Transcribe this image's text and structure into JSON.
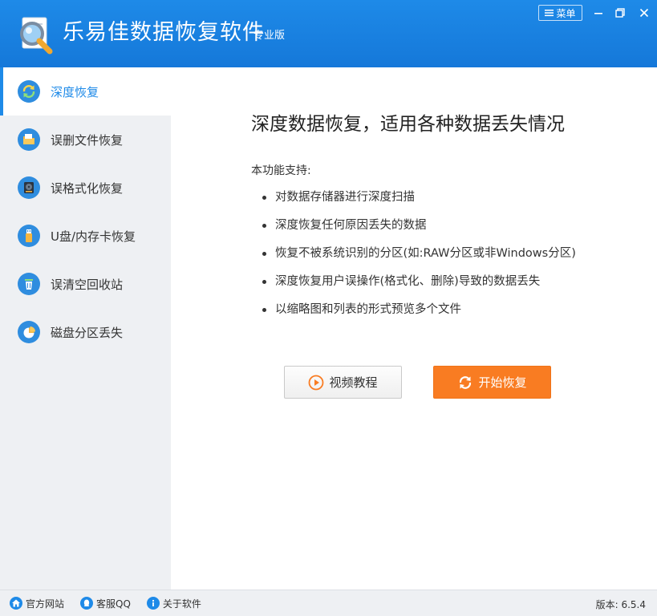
{
  "header": {
    "app_title": "乐易佳数据恢复软件",
    "edition": "专业版",
    "menu_label": "菜单",
    "accent_color": "#1e8ae8"
  },
  "sidebar": {
    "items": [
      {
        "label": "深度恢复",
        "icon": "refresh-icon",
        "active": true
      },
      {
        "label": "误删文件恢复",
        "icon": "folder-icon",
        "active": false
      },
      {
        "label": "误格式化恢复",
        "icon": "disk-icon",
        "active": false
      },
      {
        "label": "U盘/内存卡恢复",
        "icon": "usb-icon",
        "active": false
      },
      {
        "label": "误清空回收站",
        "icon": "recycle-bin-icon",
        "active": false
      },
      {
        "label": "磁盘分区丢失",
        "icon": "pie-chart-icon",
        "active": false
      }
    ]
  },
  "main": {
    "title": "深度数据恢复，适用各种数据丢失情况",
    "support_title": "本功能支持:",
    "features": [
      "对数据存储器进行深度扫描",
      "深度恢复任何原因丢失的数据",
      "恢复不被系统识别的分区(如:RAW分区或非Windows分区)",
      "深度恢复用户误操作(格式化、删除)导致的数据丢失",
      "以缩略图和列表的形式预览多个文件"
    ],
    "video_button": "视频教程",
    "start_button": "开始恢复",
    "start_color": "#f97c22"
  },
  "footer": {
    "website": "官方网站",
    "qq": "客服QQ",
    "about": "关于软件",
    "version": "版本: 6.5.4"
  }
}
